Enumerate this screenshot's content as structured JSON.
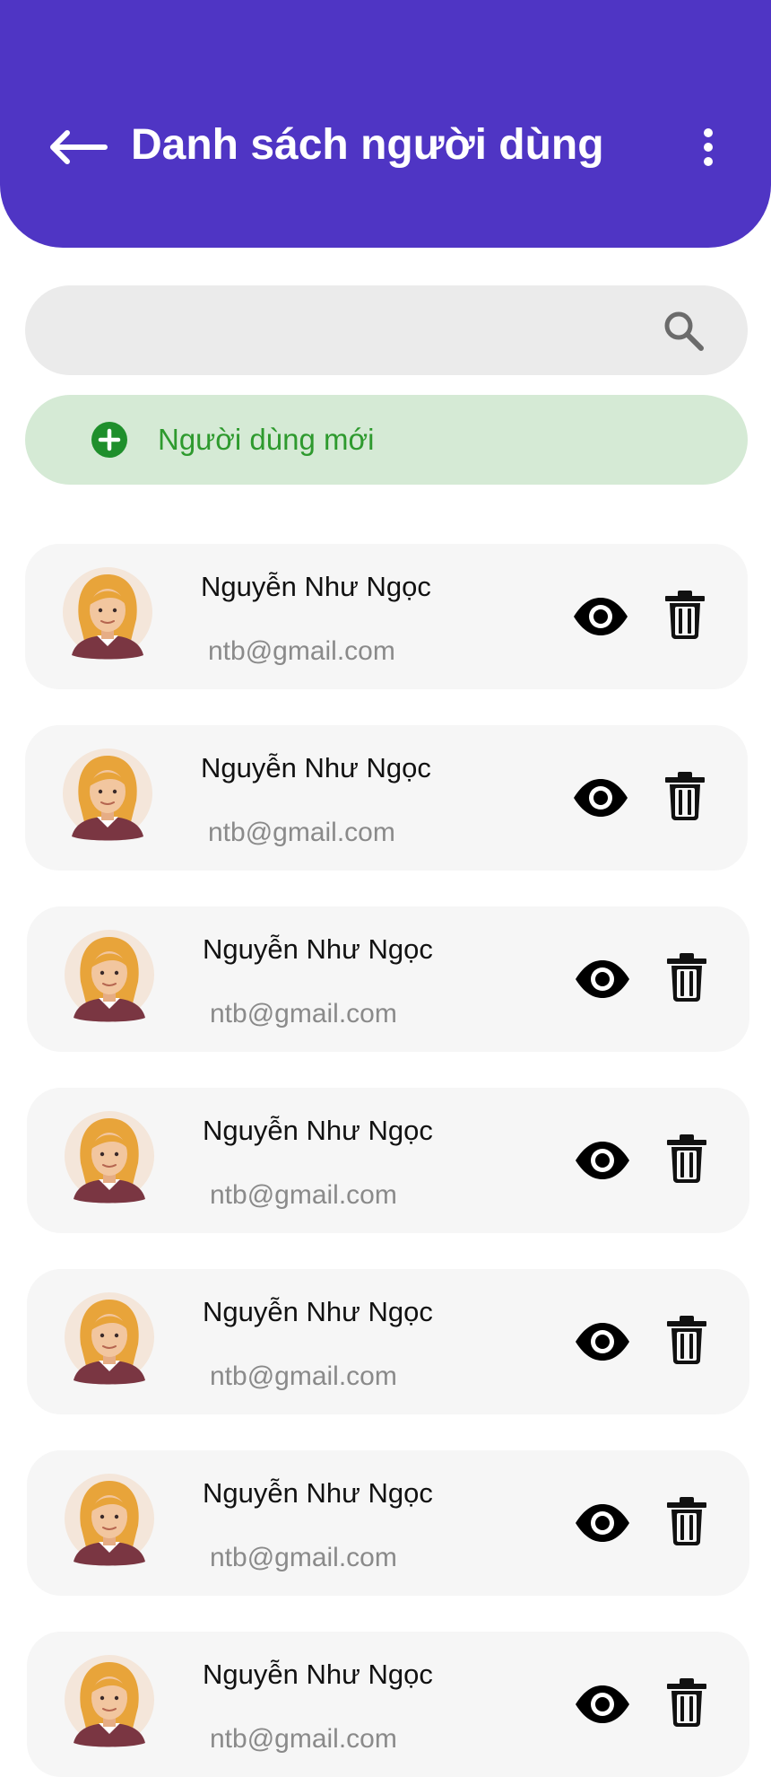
{
  "header": {
    "title": "Danh sách người dùng",
    "back_icon": "arrow-left-icon",
    "more_icon": "more-vertical-icon",
    "background_color": "#4f35c4"
  },
  "search": {
    "value": "",
    "placeholder": "",
    "icon": "search-icon"
  },
  "new_user": {
    "label": "Người dùng mới",
    "icon": "plus-circle-icon",
    "color": "#2e9a2e",
    "background_color": "#d5ead5"
  },
  "users": [
    {
      "name": "Nguyễn Như Ngọc",
      "email": "ntb@gmail.com"
    },
    {
      "name": "Nguyễn Như Ngọc",
      "email": "ntb@gmail.com"
    },
    {
      "name": "Nguyễn Như Ngọc",
      "email": "ntb@gmail.com"
    },
    {
      "name": "Nguyễn Như Ngọc",
      "email": "ntb@gmail.com"
    },
    {
      "name": "Nguyễn Như Ngọc",
      "email": "ntb@gmail.com"
    },
    {
      "name": "Nguyễn Như Ngọc",
      "email": "ntb@gmail.com"
    },
    {
      "name": "Nguyễn Như Ngọc",
      "email": "ntb@gmail.com"
    }
  ],
  "row_icons": {
    "view": "eye-icon",
    "delete": "trash-icon",
    "avatar": "user-avatar"
  }
}
